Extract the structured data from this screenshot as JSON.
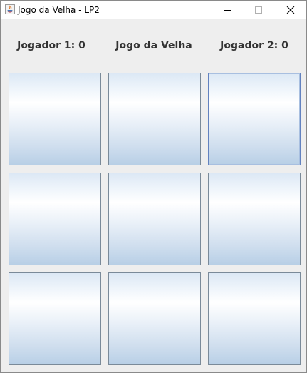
{
  "window": {
    "title": "Jogo da Velha - LP2",
    "controls": {
      "minimize_icon": "minimize-icon",
      "maximize_icon": "maximize-icon",
      "close_icon": "close-icon"
    }
  },
  "header": {
    "player1_label": "Jogador 1: 0",
    "game_title": "Jogo da Velha",
    "player2_label": "Jogador 2: 0"
  },
  "board": {
    "cells": [
      "",
      "",
      "",
      "",
      "",
      "",
      "",
      "",
      ""
    ],
    "focused_cell": 3
  },
  "colors": {
    "window_bg": "#eeeeee",
    "cell_border": "#7a8a99",
    "focus_border": "#6382bf",
    "label_text": "#333333"
  }
}
